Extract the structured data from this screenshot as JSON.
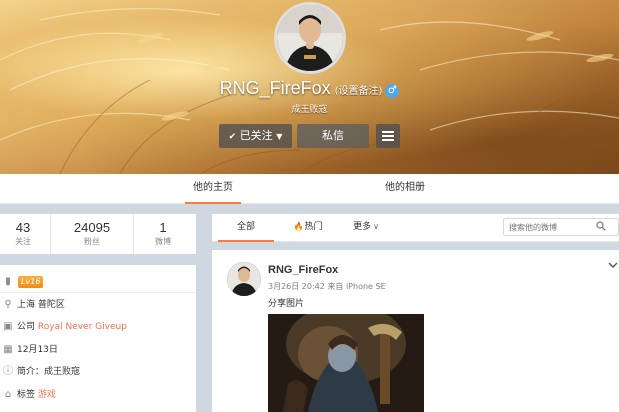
{
  "profile": {
    "nickname": "RNG_FireFox",
    "remark_link": "(设置备注)",
    "gender_symbol": "♂",
    "motto": "成王败寇",
    "follow_button": "已关注",
    "message_button": "私信"
  },
  "tabs": {
    "home": "他的主页",
    "album": "他的相册"
  },
  "stats": [
    {
      "value": "43",
      "label": "关注"
    },
    {
      "value": "24095",
      "label": "粉丝"
    },
    {
      "value": "1",
      "label": "微博"
    }
  ],
  "info": {
    "level": "Lv16",
    "location": "上海 普陀区",
    "company_label": "公司",
    "company_value": "Royal Never Giveup",
    "birthday": "12月13日",
    "intro": "简介：成王败寇",
    "tags_label": "标签",
    "tags_value": "游戏"
  },
  "feed_tabs": {
    "all": "全部",
    "hot": "热门",
    "more": "更多"
  },
  "search": {
    "placeholder": "搜索他的微博"
  },
  "post": {
    "author": "RNG_FireFox",
    "meta": "3月26日 20:42 来自 iPhone SE",
    "text": "分享图片"
  },
  "colors": {
    "accent": "#fa7d3c",
    "link_orange": "#eb7350",
    "gender_blue": "#4fa7ee",
    "page_bg": "#cfd8df"
  },
  "icons": {
    "location": "location-pin-icon",
    "company": "briefcase-icon",
    "birthday": "calendar-icon",
    "intro": "info-icon",
    "tags": "tag-icon"
  }
}
